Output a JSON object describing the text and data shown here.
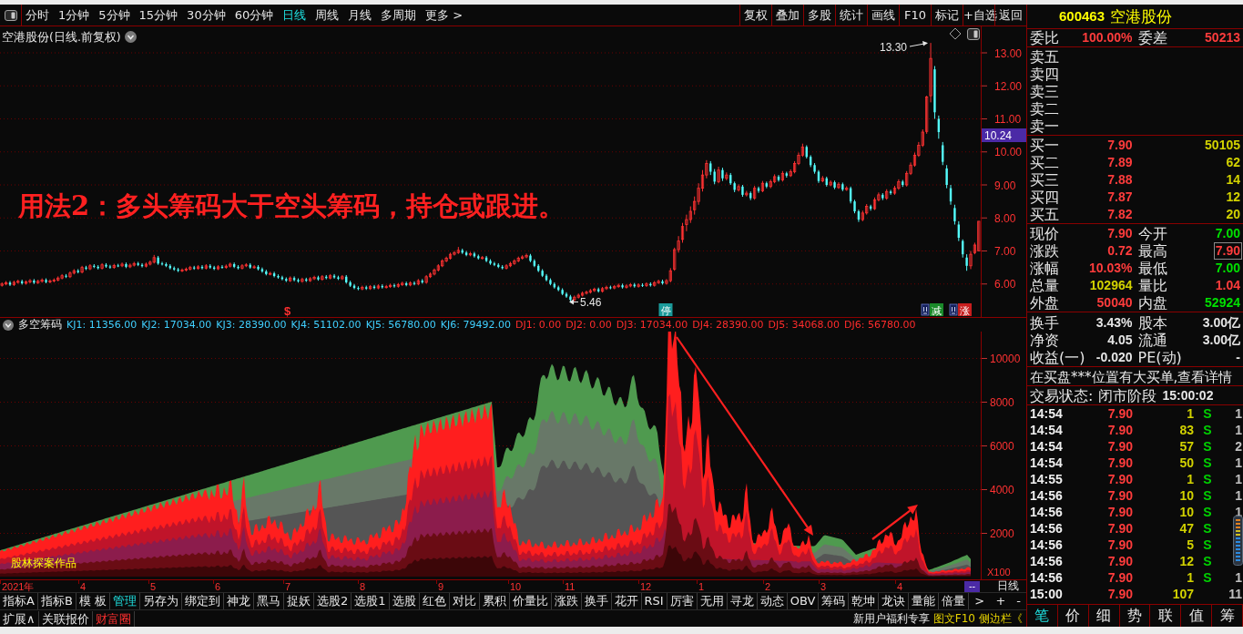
{
  "toolbar": {
    "periods": [
      {
        "label": "分时",
        "selected": false
      },
      {
        "label": "1分钟",
        "selected": false
      },
      {
        "label": "5分钟",
        "selected": false
      },
      {
        "label": "15分钟",
        "selected": false
      },
      {
        "label": "30分钟",
        "selected": false
      },
      {
        "label": "60分钟",
        "selected": false
      },
      {
        "label": "日线",
        "selected": true
      },
      {
        "label": "周线",
        "selected": false
      },
      {
        "label": "月线",
        "selected": false
      },
      {
        "label": "多周期",
        "selected": false
      },
      {
        "label": "更多 >",
        "selected": false
      }
    ],
    "actions": [
      "复权",
      "叠加",
      "多股",
      "统计",
      "画线",
      "F10",
      "标记",
      "+自选",
      "返回"
    ]
  },
  "price_chart": {
    "title": "空港股份(日线.前复权)",
    "last_price_tag": "10.24",
    "annotation": "用法2：多头筹码大于空头筹码，持仓或跟进。",
    "high_label": "13.30",
    "low_label": "5.46",
    "event_markers": [
      {
        "text": "$",
        "kind": "letter",
        "color": "#ff3030"
      },
      {
        "text": "停",
        "kind": "tag",
        "color": "#1a9a9a"
      },
      {
        "text": "减",
        "kind": "info_tag",
        "color": "#1a8a2a"
      },
      {
        "text": "涨",
        "kind": "info_tag",
        "color": "#c81e1e"
      }
    ],
    "chart_data": {
      "type": "candlestick",
      "grid": true,
      "ylim": [
        5.0,
        13.8
      ],
      "yticks": [
        {
          "value": 13,
          "label": "13.00"
        },
        {
          "value": 12,
          "label": "12.00"
        },
        {
          "value": 11,
          "label": "11.00"
        },
        {
          "value": 10,
          "label": "10.00"
        },
        {
          "value": 9,
          "label": "9.00"
        },
        {
          "value": 8,
          "label": "8.00"
        },
        {
          "value": 7,
          "label": "7.00"
        },
        {
          "value": 6,
          "label": "6.00"
        }
      ],
      "categories": [
        null,
        null,
        null,
        null,
        null,
        null,
        null,
        null,
        null,
        null,
        null,
        null,
        null,
        null,
        null,
        null,
        null,
        null,
        null,
        null,
        null,
        null,
        null,
        null,
        null,
        null,
        null,
        null,
        null,
        null,
        null,
        null,
        null,
        null,
        null,
        null,
        null,
        null,
        null,
        null,
        null,
        null,
        null,
        null,
        null,
        null,
        null,
        null,
        null,
        null,
        null,
        null,
        null,
        null,
        null,
        null,
        null,
        null,
        null,
        null,
        null,
        null,
        null,
        null,
        null,
        null,
        null,
        null,
        null,
        null,
        null,
        null,
        null,
        null,
        null,
        null,
        null,
        null,
        null,
        null,
        null,
        null,
        null,
        null,
        null,
        null,
        null,
        null,
        null,
        null,
        null,
        null,
        null,
        null,
        null,
        null,
        null,
        null,
        null,
        null,
        null,
        null,
        null,
        null,
        null,
        null,
        null,
        null,
        null,
        null,
        null,
        null,
        null,
        null,
        null,
        null,
        null,
        null,
        null,
        null,
        null,
        null,
        null,
        null,
        null,
        null,
        null,
        null,
        null,
        null,
        null,
        null,
        null,
        null,
        null,
        null,
        null,
        null,
        null,
        null,
        null,
        null,
        null,
        null,
        null,
        null,
        null,
        null,
        null,
        null,
        null,
        null,
        null,
        null,
        null,
        null,
        null,
        null,
        null,
        null,
        null,
        null,
        null,
        null,
        null,
        null,
        null,
        null,
        null,
        null,
        null,
        null,
        null,
        null,
        null,
        null,
        null,
        null,
        null,
        null,
        null,
        null,
        null,
        null,
        null,
        null,
        null,
        null,
        null,
        null,
        null,
        null,
        null,
        null,
        null,
        null,
        null,
        null,
        null,
        null,
        null,
        null,
        null,
        null,
        null,
        null,
        null,
        null,
        null,
        null,
        null,
        null,
        null,
        null,
        null,
        null,
        null,
        null,
        null,
        null,
        null,
        null,
        null,
        null,
        null,
        null,
        null,
        null,
        null,
        null,
        null,
        null,
        null,
        null,
        null,
        null,
        null,
        null,
        null,
        null,
        null,
        null,
        null,
        null,
        null
      ],
      "ohlc": [
        [
          5.96,
          6.05,
          5.92,
          6.0
        ],
        [
          6.0,
          6.09,
          5.96,
          6.04
        ],
        [
          6.04,
          6.09,
          5.94,
          5.98
        ],
        [
          5.98,
          6.1,
          5.94,
          6.05
        ],
        [
          6.05,
          6.13,
          6.01,
          6.08
        ],
        [
          6.08,
          6.13,
          5.98,
          6.02
        ],
        [
          6.02,
          6.11,
          5.98,
          6.06
        ],
        [
          6.06,
          6.15,
          6.02,
          6.1
        ],
        [
          6.1,
          6.15,
          6.0,
          6.04
        ],
        [
          6.04,
          6.13,
          6.0,
          6.08
        ],
        [
          6.08,
          6.17,
          6.04,
          6.12
        ],
        [
          6.12,
          6.17,
          6.02,
          6.06
        ],
        [
          6.06,
          6.14,
          6.02,
          6.09
        ],
        [
          6.09,
          6.17,
          6.05,
          6.12
        ],
        [
          6.12,
          6.23,
          6.08,
          6.18
        ],
        [
          6.18,
          6.3,
          6.14,
          6.25
        ],
        [
          6.25,
          6.3,
          6.18,
          6.22
        ],
        [
          6.22,
          6.38,
          6.18,
          6.33
        ],
        [
          6.33,
          6.45,
          6.29,
          6.4
        ],
        [
          6.4,
          6.45,
          6.32,
          6.36
        ],
        [
          6.36,
          6.55,
          6.32,
          6.5
        ],
        [
          6.5,
          6.55,
          6.42,
          6.46
        ],
        [
          6.46,
          6.6,
          6.42,
          6.55
        ],
        [
          6.55,
          6.6,
          6.48,
          6.52
        ],
        [
          6.52,
          6.57,
          6.44,
          6.48
        ],
        [
          6.48,
          6.63,
          6.44,
          6.58
        ],
        [
          6.58,
          6.63,
          6.49,
          6.53
        ],
        [
          6.53,
          6.58,
          6.46,
          6.5
        ],
        [
          6.5,
          6.61,
          6.46,
          6.56
        ],
        [
          6.56,
          6.61,
          6.51,
          6.55
        ],
        [
          6.55,
          6.65,
          6.51,
          6.6
        ],
        [
          6.6,
          6.65,
          6.48,
          6.52
        ],
        [
          6.52,
          6.62,
          6.48,
          6.57
        ],
        [
          6.57,
          6.67,
          6.53,
          6.62
        ],
        [
          6.62,
          6.67,
          6.54,
          6.58
        ],
        [
          6.58,
          6.63,
          6.5,
          6.54
        ],
        [
          6.54,
          6.65,
          6.5,
          6.6
        ],
        [
          6.6,
          6.71,
          6.56,
          6.66
        ],
        [
          6.66,
          6.88,
          6.62,
          6.8
        ],
        [
          6.8,
          6.85,
          6.58,
          6.62
        ],
        [
          6.62,
          6.67,
          6.56,
          6.6
        ],
        [
          6.6,
          6.65,
          6.51,
          6.55
        ],
        [
          6.55,
          6.6,
          6.44,
          6.48
        ],
        [
          6.48,
          6.53,
          6.4,
          6.44
        ],
        [
          6.44,
          6.49,
          6.36,
          6.4
        ],
        [
          6.4,
          6.47,
          6.36,
          6.42
        ],
        [
          6.42,
          6.5,
          6.38,
          6.45
        ],
        [
          6.45,
          6.55,
          6.41,
          6.5
        ],
        [
          6.5,
          6.55,
          6.43,
          6.47
        ],
        [
          6.47,
          6.57,
          6.43,
          6.52
        ],
        [
          6.52,
          6.57,
          6.44,
          6.48
        ],
        [
          6.48,
          6.6,
          6.44,
          6.55
        ],
        [
          6.55,
          6.6,
          6.46,
          6.5
        ],
        [
          6.5,
          6.55,
          6.42,
          6.46
        ],
        [
          6.46,
          6.57,
          6.42,
          6.52
        ],
        [
          6.52,
          6.57,
          6.46,
          6.5
        ],
        [
          6.5,
          6.59,
          6.46,
          6.54
        ],
        [
          6.54,
          6.65,
          6.5,
          6.6
        ],
        [
          6.6,
          6.65,
          6.48,
          6.52
        ],
        [
          6.52,
          6.57,
          6.44,
          6.48
        ],
        [
          6.48,
          6.6,
          6.44,
          6.55
        ],
        [
          6.55,
          6.63,
          6.51,
          6.58
        ],
        [
          6.58,
          6.63,
          6.46,
          6.5
        ],
        [
          6.5,
          6.57,
          6.46,
          6.52
        ],
        [
          6.52,
          6.57,
          6.41,
          6.45
        ],
        [
          6.45,
          6.5,
          6.34,
          6.38
        ],
        [
          6.38,
          6.43,
          6.26,
          6.3
        ],
        [
          6.3,
          6.37,
          6.26,
          6.32
        ],
        [
          6.32,
          6.37,
          6.2,
          6.24
        ],
        [
          6.24,
          6.29,
          6.16,
          6.2
        ],
        [
          6.2,
          6.25,
          6.11,
          6.15
        ],
        [
          6.15,
          6.2,
          6.06,
          6.1
        ],
        [
          6.1,
          6.23,
          6.06,
          6.18
        ],
        [
          6.18,
          6.23,
          6.08,
          6.12
        ],
        [
          6.12,
          6.17,
          6.04,
          6.08
        ],
        [
          6.08,
          6.19,
          6.04,
          6.14
        ],
        [
          6.14,
          6.19,
          6.06,
          6.1
        ],
        [
          6.1,
          6.21,
          6.06,
          6.16
        ],
        [
          6.16,
          6.25,
          6.12,
          6.2
        ],
        [
          6.2,
          6.25,
          6.1,
          6.14
        ],
        [
          6.14,
          6.27,
          6.1,
          6.22
        ],
        [
          6.22,
          6.27,
          6.14,
          6.18
        ],
        [
          6.18,
          6.3,
          6.14,
          6.25
        ],
        [
          6.25,
          6.3,
          6.16,
          6.2
        ],
        [
          6.2,
          6.25,
          6.12,
          6.16
        ],
        [
          6.16,
          6.27,
          6.12,
          6.22
        ],
        [
          6.22,
          6.27,
          6.01,
          6.05
        ],
        [
          6.05,
          6.1,
          5.91,
          5.95
        ],
        [
          5.95,
          6.0,
          5.84,
          5.88
        ],
        [
          5.88,
          5.93,
          5.81,
          5.85
        ],
        [
          5.85,
          5.95,
          5.81,
          5.9
        ],
        [
          5.9,
          5.95,
          5.82,
          5.86
        ],
        [
          5.86,
          5.97,
          5.82,
          5.92
        ],
        [
          5.92,
          5.97,
          5.84,
          5.88
        ],
        [
          5.88,
          5.99,
          5.84,
          5.94
        ],
        [
          5.94,
          5.99,
          5.86,
          5.9
        ],
        [
          5.9,
          5.97,
          5.86,
          5.92
        ],
        [
          5.92,
          6.01,
          5.88,
          5.96
        ],
        [
          5.96,
          6.01,
          5.89,
          5.93
        ],
        [
          5.93,
          6.03,
          5.89,
          5.98
        ],
        [
          5.98,
          6.07,
          5.94,
          6.02
        ],
        [
          6.02,
          6.07,
          5.93,
          5.97
        ],
        [
          5.97,
          6.08,
          5.93,
          6.03
        ],
        [
          6.03,
          6.08,
          5.96,
          6.0
        ],
        [
          6.0,
          6.15,
          5.96,
          6.1
        ],
        [
          6.1,
          6.15,
          6.01,
          6.05
        ],
        [
          6.05,
          6.27,
          6.01,
          6.22
        ],
        [
          6.22,
          6.35,
          6.18,
          6.3
        ],
        [
          6.3,
          6.47,
          6.26,
          6.42
        ],
        [
          6.42,
          6.6,
          6.38,
          6.55
        ],
        [
          6.55,
          6.75,
          6.51,
          6.7
        ],
        [
          6.7,
          6.83,
          6.66,
          6.78
        ],
        [
          6.78,
          6.95,
          6.74,
          6.9
        ],
        [
          6.9,
          7.0,
          6.86,
          6.95
        ],
        [
          6.95,
          7.12,
          6.91,
          7.02
        ],
        [
          7.02,
          7.07,
          6.91,
          6.95
        ],
        [
          6.95,
          7.0,
          6.84,
          6.88
        ],
        [
          6.88,
          6.97,
          6.84,
          6.92
        ],
        [
          6.92,
          6.97,
          6.8,
          6.84
        ],
        [
          6.84,
          6.89,
          6.74,
          6.78
        ],
        [
          6.78,
          6.85,
          6.74,
          6.8
        ],
        [
          6.8,
          6.85,
          6.66,
          6.7
        ],
        [
          6.7,
          6.75,
          6.58,
          6.62
        ],
        [
          6.62,
          6.67,
          6.54,
          6.58
        ],
        [
          6.58,
          6.63,
          6.48,
          6.52
        ],
        [
          6.52,
          6.57,
          6.44,
          6.48
        ],
        [
          6.48,
          6.6,
          6.44,
          6.55
        ],
        [
          6.55,
          6.67,
          6.51,
          6.62
        ],
        [
          6.62,
          6.75,
          6.58,
          6.7
        ],
        [
          6.7,
          6.83,
          6.66,
          6.78
        ],
        [
          6.78,
          6.87,
          6.74,
          6.82
        ],
        [
          6.82,
          6.92,
          6.78,
          6.86
        ],
        [
          6.86,
          6.91,
          6.66,
          6.7
        ],
        [
          6.7,
          6.75,
          6.51,
          6.55
        ],
        [
          6.55,
          6.6,
          6.36,
          6.4
        ],
        [
          6.4,
          6.45,
          6.21,
          6.25
        ],
        [
          6.25,
          6.3,
          6.08,
          6.12
        ],
        [
          6.12,
          6.17,
          5.96,
          6.0
        ],
        [
          6.0,
          6.05,
          5.86,
          5.9
        ],
        [
          5.9,
          5.95,
          5.78,
          5.82
        ],
        [
          5.82,
          5.87,
          5.66,
          5.7
        ],
        [
          5.7,
          5.75,
          5.58,
          5.62
        ],
        [
          5.62,
          5.67,
          5.46,
          5.52
        ],
        [
          5.52,
          5.65,
          5.48,
          5.6
        ],
        [
          5.6,
          5.71,
          5.56,
          5.66
        ],
        [
          5.66,
          5.77,
          5.62,
          5.72
        ],
        [
          5.72,
          5.8,
          5.68,
          5.75
        ],
        [
          5.75,
          5.85,
          5.71,
          5.8
        ],
        [
          5.8,
          5.89,
          5.76,
          5.84
        ],
        [
          5.84,
          5.89,
          5.74,
          5.78
        ],
        [
          5.78,
          5.91,
          5.74,
          5.86
        ],
        [
          5.86,
          5.95,
          5.82,
          5.9
        ],
        [
          5.9,
          5.95,
          5.84,
          5.88
        ],
        [
          5.88,
          5.97,
          5.84,
          5.92
        ],
        [
          5.92,
          6.01,
          5.88,
          5.96
        ],
        [
          5.96,
          6.01,
          5.86,
          5.9
        ],
        [
          5.9,
          5.99,
          5.86,
          5.94
        ],
        [
          5.94,
          6.03,
          5.9,
          5.98
        ],
        [
          5.98,
          6.03,
          5.89,
          5.93
        ],
        [
          5.93,
          6.02,
          5.89,
          5.97
        ],
        [
          5.97,
          6.02,
          5.91,
          5.95
        ],
        [
          5.95,
          6.05,
          5.91,
          6.0
        ],
        [
          6.0,
          6.05,
          5.92,
          5.96
        ],
        [
          5.96,
          6.09,
          5.92,
          6.04
        ],
        [
          6.04,
          6.13,
          6.0,
          6.08
        ],
        [
          6.08,
          6.13,
          5.98,
          6.02
        ],
        [
          6.02,
          6.15,
          5.98,
          6.1
        ],
        [
          6.1,
          6.48,
          6.05,
          6.4
        ],
        [
          6.45,
          7.1,
          6.4,
          7.04
        ],
        [
          7.04,
          7.45,
          6.95,
          7.3
        ],
        [
          7.35,
          7.85,
          7.25,
          7.74
        ],
        [
          7.8,
          8.1,
          7.6,
          7.95
        ],
        [
          7.95,
          8.35,
          7.85,
          8.2
        ],
        [
          8.25,
          8.65,
          8.1,
          8.5
        ],
        [
          8.5,
          9.05,
          8.4,
          8.9
        ],
        [
          8.9,
          9.45,
          8.8,
          9.3
        ],
        [
          9.3,
          9.75,
          9.2,
          9.65
        ],
        [
          9.65,
          9.72,
          9.3,
          9.4
        ],
        [
          9.4,
          9.48,
          9.02,
          9.1
        ],
        [
          9.1,
          9.55,
          9.05,
          9.45
        ],
        [
          9.45,
          9.52,
          9.12,
          9.2
        ],
        [
          9.2,
          9.38,
          9.14,
          9.3
        ],
        [
          9.3,
          9.36,
          9.0,
          9.05
        ],
        [
          9.05,
          9.1,
          8.78,
          8.85
        ],
        [
          8.85,
          9.02,
          8.8,
          8.95
        ],
        [
          8.95,
          9.0,
          8.64,
          8.7
        ],
        [
          8.7,
          8.82,
          8.65,
          8.75
        ],
        [
          8.75,
          8.8,
          8.54,
          8.6
        ],
        [
          8.6,
          8.97,
          8.55,
          8.9
        ],
        [
          8.9,
          8.95,
          8.76,
          8.82
        ],
        [
          8.82,
          9.12,
          8.78,
          9.05
        ],
        [
          9.05,
          9.1,
          8.9,
          8.95
        ],
        [
          8.95,
          9.16,
          8.9,
          9.1
        ],
        [
          9.1,
          9.32,
          9.05,
          9.25
        ],
        [
          9.25,
          9.3,
          9.1,
          9.15
        ],
        [
          9.15,
          9.42,
          9.1,
          9.35
        ],
        [
          9.35,
          9.4,
          9.22,
          9.28
        ],
        [
          9.28,
          9.47,
          9.24,
          9.4
        ],
        [
          9.4,
          9.72,
          9.35,
          9.65
        ],
        [
          9.65,
          9.98,
          9.6,
          9.9
        ],
        [
          9.9,
          10.25,
          9.85,
          10.15
        ],
        [
          10.15,
          10.2,
          9.8,
          9.85
        ],
        [
          9.85,
          9.9,
          9.54,
          9.6
        ],
        [
          9.6,
          9.66,
          9.34,
          9.4
        ],
        [
          9.4,
          9.45,
          9.06,
          9.12
        ],
        [
          9.12,
          9.27,
          9.08,
          9.2
        ],
        [
          9.2,
          9.25,
          8.95,
          9.0
        ],
        [
          9.0,
          9.14,
          8.96,
          9.08
        ],
        [
          9.08,
          9.13,
          8.87,
          8.92
        ],
        [
          8.92,
          9.08,
          8.88,
          9.02
        ],
        [
          9.02,
          9.07,
          8.81,
          8.86
        ],
        [
          8.86,
          8.96,
          8.82,
          8.9
        ],
        [
          8.9,
          8.95,
          8.44,
          8.5
        ],
        [
          8.5,
          8.55,
          8.14,
          8.2
        ],
        [
          8.2,
          8.25,
          7.88,
          7.95
        ],
        [
          7.95,
          8.22,
          7.9,
          8.15
        ],
        [
          8.15,
          8.42,
          8.1,
          8.35
        ],
        [
          8.35,
          8.4,
          8.22,
          8.28
        ],
        [
          8.28,
          8.62,
          8.24,
          8.55
        ],
        [
          8.55,
          8.77,
          8.5,
          8.7
        ],
        [
          8.7,
          8.75,
          8.54,
          8.6
        ],
        [
          8.6,
          8.87,
          8.55,
          8.8
        ],
        [
          8.8,
          8.85,
          8.7,
          8.75
        ],
        [
          8.75,
          8.97,
          8.7,
          8.9
        ],
        [
          8.9,
          9.17,
          8.85,
          9.1
        ],
        [
          9.1,
          9.15,
          8.94,
          9.0
        ],
        [
          9.0,
          9.42,
          8.95,
          9.35
        ],
        [
          9.35,
          9.68,
          9.3,
          9.6
        ],
        [
          9.6,
          9.98,
          9.55,
          9.9
        ],
        [
          9.9,
          10.3,
          9.85,
          10.2
        ],
        [
          10.2,
          10.68,
          10.15,
          10.6
        ],
        [
          10.62,
          11.7,
          10.55,
          11.66
        ],
        [
          11.7,
          13.3,
          11.5,
          12.83
        ],
        [
          12.5,
          12.6,
          11.0,
          11.2
        ],
        [
          11.0,
          11.1,
          10.4,
          10.6
        ],
        [
          10.2,
          10.3,
          9.6,
          9.7
        ],
        [
          9.5,
          9.6,
          8.9,
          9.0
        ],
        [
          8.9,
          9.0,
          8.4,
          8.5
        ],
        [
          8.3,
          8.4,
          7.8,
          7.9
        ],
        [
          7.8,
          7.9,
          7.3,
          7.4
        ],
        [
          7.3,
          7.35,
          6.8,
          6.9
        ],
        [
          6.8,
          6.9,
          6.4,
          6.55
        ],
        [
          6.55,
          7.0,
          6.45,
          6.9
        ],
        [
          6.95,
          7.25,
          6.9,
          7.18
        ],
        [
          7.0,
          7.9,
          7.0,
          7.9
        ]
      ]
    }
  },
  "indicator": {
    "name": "多空筹码",
    "legend": [
      {
        "text": "KJ1: 11356.00",
        "color": "#40d0ff"
      },
      {
        "text": "KJ2: 17034.00",
        "color": "#40d0ff"
      },
      {
        "text": "KJ3: 28390.00",
        "color": "#40d0ff"
      },
      {
        "text": "KJ4: 51102.00",
        "color": "#40d0ff"
      },
      {
        "text": "KJ5: 56780.00",
        "color": "#40d0ff"
      },
      {
        "text": "KJ6: 79492.00",
        "color": "#40d0ff"
      },
      {
        "text": "DJ1: 0.00",
        "color": "#ff2c2c"
      },
      {
        "text": "DJ2: 0.00",
        "color": "#ff2c2c"
      },
      {
        "text": "DJ3: 17034.00",
        "color": "#ff2c2c"
      },
      {
        "text": "DJ4: 28390.00",
        "color": "#ff2c2c"
      },
      {
        "text": "DJ5: 34068.00",
        "color": "#ff2c2c"
      },
      {
        "text": "DJ6: 56780.00",
        "color": "#ff2c2c"
      }
    ],
    "yticks": [
      "10000",
      "8000",
      "6000",
      "4000",
      "2000"
    ],
    "scale_label": "X100",
    "credit": "股林探案作品"
  },
  "time_axis": {
    "labels": [
      "2021年",
      "4",
      "5",
      "6",
      "7",
      "8",
      "9",
      "10",
      "11",
      "12",
      "1",
      "2",
      "3",
      "4"
    ],
    "corner_button": "--",
    "period_button": "日线"
  },
  "indicator_tabs": {
    "items": [
      {
        "label": "指标A",
        "selected": false
      },
      {
        "label": "指标B",
        "selected": false
      },
      {
        "label": "模 板",
        "selected": false
      },
      {
        "label": "管理",
        "selected": true
      },
      {
        "label": "另存为",
        "selected": false
      },
      {
        "label": "绑定到",
        "selected": false
      },
      {
        "label": "神龙",
        "selected": false
      },
      {
        "label": "黑马",
        "selected": false
      },
      {
        "label": "捉妖",
        "selected": false
      },
      {
        "label": "选股2",
        "selected": false
      },
      {
        "label": "选股1",
        "selected": false
      },
      {
        "label": "选股",
        "selected": false
      },
      {
        "label": "红色",
        "selected": false
      },
      {
        "label": "对比",
        "selected": false
      },
      {
        "label": "累积",
        "selected": false
      },
      {
        "label": "价量比",
        "selected": false
      },
      {
        "label": "涨跌",
        "selected": false
      },
      {
        "label": "换手",
        "selected": false
      },
      {
        "label": "花开",
        "selected": false
      },
      {
        "label": "RSI",
        "selected": false
      },
      {
        "label": "厉害",
        "selected": false
      },
      {
        "label": "无用",
        "selected": false
      },
      {
        "label": "寻龙",
        "selected": false
      },
      {
        "label": "动态",
        "selected": false
      },
      {
        "label": "OBV",
        "selected": false
      },
      {
        "label": "筹码",
        "selected": false
      },
      {
        "label": "乾坤",
        "selected": false
      },
      {
        "label": "龙诀",
        "selected": false
      },
      {
        "label": "量能",
        "selected": false
      },
      {
        "label": "倍量",
        "selected": false
      }
    ],
    "more_arrow": ">",
    "zoom_buttons": [
      "+",
      "-"
    ]
  },
  "footer": {
    "items": [
      {
        "label": "扩展∧",
        "kind": "plain"
      },
      {
        "label": "关联报价",
        "kind": "plain"
      },
      {
        "label": "财富圈",
        "kind": "accent"
      }
    ],
    "promo": "新用户福利专享",
    "links": [
      "图文F10",
      "侧边栏《"
    ]
  },
  "quote": {
    "code": "600463",
    "name": "空港股份",
    "order_ratio": [
      {
        "label": "委比",
        "value": "100.00%"
      },
      {
        "label": "委差",
        "value": "50213"
      }
    ],
    "asks": [
      {
        "label": "卖五"
      },
      {
        "label": "卖四"
      },
      {
        "label": "卖三"
      },
      {
        "label": "卖二"
      },
      {
        "label": "卖一"
      }
    ],
    "bids": [
      {
        "label": "买一",
        "price": "7.90",
        "volume": "50105"
      },
      {
        "label": "买二",
        "price": "7.89",
        "volume": "62"
      },
      {
        "label": "买三",
        "price": "7.88",
        "volume": "14"
      },
      {
        "label": "买四",
        "price": "7.87",
        "volume": "12"
      },
      {
        "label": "买五",
        "price": "7.82",
        "volume": "20"
      }
    ],
    "stats": [
      {
        "label": "现价",
        "value": "7.90",
        "color": "#ff3c3c",
        "outlined": false
      },
      {
        "label": "今开",
        "value": "7.00",
        "color": "#00e000",
        "outlined": false
      },
      {
        "label": "涨跌",
        "value": "0.72",
        "color": "#ff3c3c",
        "outlined": false
      },
      {
        "label": "最高",
        "value": "7.90",
        "color": "#ff3c3c",
        "outlined": true
      },
      {
        "label": "涨幅",
        "value": "10.03%",
        "color": "#ff3c3c",
        "outlined": false
      },
      {
        "label": "最低",
        "value": "7.00",
        "color": "#00e000",
        "outlined": false
      },
      {
        "label": "总量",
        "value": "102964",
        "color": "#d2d200",
        "outlined": false
      },
      {
        "label": "量比",
        "value": "1.04",
        "color": "#ff3c3c",
        "outlined": false
      },
      {
        "label": "外盘",
        "value": "50040",
        "color": "#ff3c3c",
        "outlined": false
      },
      {
        "label": "内盘",
        "value": "52924",
        "color": "#00e000",
        "outlined": false
      }
    ],
    "fundamentals": [
      {
        "label": "换手",
        "value": "3.43%"
      },
      {
        "label": "股本",
        "value": "3.00亿"
      },
      {
        "label": "净资",
        "value": "4.05"
      },
      {
        "label": "流通",
        "value": "3.00亿"
      },
      {
        "label": "收益(一)",
        "value": "-0.020"
      },
      {
        "label": "PE(动)",
        "value": "-"
      }
    ],
    "notice": "在买盘***位置有大买单,查看详情",
    "status": {
      "label": "交易状态:",
      "phase": "闭市阶段",
      "time": "15:00:02"
    },
    "trades": [
      {
        "time": "14:54",
        "price": "7.90",
        "volume": "1",
        "side": "S",
        "color": "#00d200",
        "count": "1"
      },
      {
        "time": "14:54",
        "price": "7.90",
        "volume": "83",
        "side": "S",
        "color": "#00d200",
        "count": "1"
      },
      {
        "time": "14:54",
        "price": "7.90",
        "volume": "57",
        "side": "S",
        "color": "#00d200",
        "count": "2"
      },
      {
        "time": "14:54",
        "price": "7.90",
        "volume": "50",
        "side": "S",
        "color": "#00d200",
        "count": "1"
      },
      {
        "time": "14:55",
        "price": "7.90",
        "volume": "1",
        "side": "S",
        "color": "#00d200",
        "count": "1"
      },
      {
        "time": "14:56",
        "price": "7.90",
        "volume": "10",
        "side": "S",
        "color": "#00d200",
        "count": "1"
      },
      {
        "time": "14:56",
        "price": "7.90",
        "volume": "10",
        "side": "S",
        "color": "#00d200",
        "count": "1"
      },
      {
        "time": "14:56",
        "price": "7.90",
        "volume": "47",
        "side": "S",
        "color": "#00d200"
      },
      {
        "time": "14:56",
        "price": "7.90",
        "volume": "5",
        "side": "S",
        "color": "#00d200"
      },
      {
        "time": "14:56",
        "price": "7.90",
        "volume": "12",
        "side": "S",
        "color": "#00d200"
      },
      {
        "time": "14:56",
        "price": "7.90",
        "volume": "1",
        "side": "S",
        "color": "#00d200",
        "count": "1"
      },
      {
        "time": "15:00",
        "price": "7.90",
        "volume": "107",
        "count": "11"
      }
    ],
    "tabs": [
      {
        "label": "笔",
        "selected": true
      },
      {
        "label": "价",
        "selected": false
      },
      {
        "label": "细",
        "selected": false
      },
      {
        "label": "势",
        "selected": false
      },
      {
        "label": "联",
        "selected": false
      },
      {
        "label": "值",
        "selected": false
      },
      {
        "label": "筹",
        "selected": false
      }
    ]
  }
}
